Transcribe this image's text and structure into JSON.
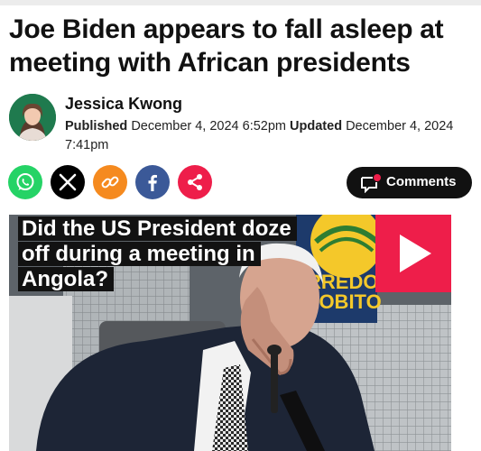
{
  "article": {
    "headline": "Joe Biden appears to fall asleep at meeting with African presidents",
    "author": "Jessica Kwong",
    "published_label": "Published",
    "published_time": "December 4, 2024 6:52pm",
    "updated_label": "Updated",
    "updated_time": "December 4, 2024 7:41pm"
  },
  "share": {
    "buttons": [
      {
        "icon": "whatsapp-icon",
        "color": "#25d366"
      },
      {
        "icon": "x-icon",
        "color": "#000000"
      },
      {
        "icon": "link-icon",
        "color": "#f58a1f"
      },
      {
        "icon": "facebook-icon",
        "color": "#3b5998"
      },
      {
        "icon": "share-icon",
        "color": "#ee1e4a"
      }
    ],
    "comments_label": "Comments",
    "comments_icon": "comment-bubble-icon"
  },
  "video": {
    "caption_line1": "Did the US President doze",
    "caption_line2": "off during a meeting in",
    "caption_line3": "Angola?",
    "sign_text1": "RREDO",
    "sign_text2": "LOBITO",
    "play_icon": "play-icon",
    "play_color": "#ee1e4a"
  }
}
